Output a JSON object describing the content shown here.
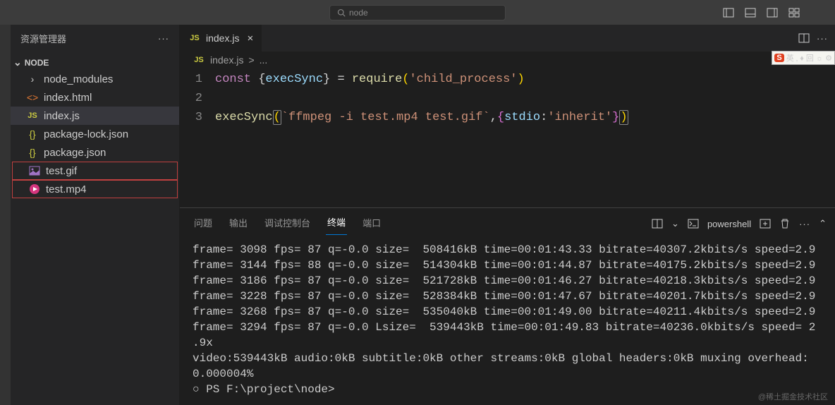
{
  "titlebar": {
    "search_text": "node"
  },
  "sidebar": {
    "title": "资源管理器",
    "folder": "NODE",
    "items": [
      {
        "name": "node_modules",
        "icon": "chev",
        "type": "folder"
      },
      {
        "name": "index.html",
        "icon": "html"
      },
      {
        "name": "index.js",
        "icon": "js",
        "active": true
      },
      {
        "name": "package-lock.json",
        "icon": "json"
      },
      {
        "name": "package.json",
        "icon": "json"
      },
      {
        "name": "test.gif",
        "icon": "img",
        "highlight": true
      },
      {
        "name": "test.mp4",
        "icon": "vid",
        "highlight": true
      }
    ]
  },
  "tab": {
    "filename": "index.js"
  },
  "breadcrumb": {
    "file": "index.js",
    "sep": ">",
    "more": "..."
  },
  "code": {
    "lines": [
      "1",
      "2",
      "3"
    ],
    "l1_const": "const",
    "l1_brace_open": " {",
    "l1_execSync": "execSync",
    "l1_brace_close": "}",
    "l1_eq": " = ",
    "l1_require": "require",
    "l1_paren_open": "(",
    "l1_str": "'child_process'",
    "l1_paren_close": ")",
    "l3_execSync": "execSync",
    "l3_paren_open": "(",
    "l3_str": "`ffmpeg -i test.mp4 test.gif`",
    "l3_comma": ",",
    "l3_opt_open": "{",
    "l3_stdio": "stdio",
    "l3_colon": ":",
    "l3_inherit": "'inherit'",
    "l3_opt_close": "}",
    "l3_paren_close": ")"
  },
  "terminal": {
    "tabs": [
      "问题",
      "输出",
      "调试控制台",
      "终端",
      "端口"
    ],
    "active_tab": 3,
    "shell": "powershell",
    "lines": [
      "frame= 3098 fps= 87 q=-0.0 size=  508416kB time=00:01:43.33 bitrate=40307.2kbits/s speed=2.9",
      "frame= 3144 fps= 88 q=-0.0 size=  514304kB time=00:01:44.87 bitrate=40175.2kbits/s speed=2.9",
      "frame= 3186 fps= 87 q=-0.0 size=  521728kB time=00:01:46.27 bitrate=40218.3kbits/s speed=2.9",
      "frame= 3228 fps= 87 q=-0.0 size=  528384kB time=00:01:47.67 bitrate=40201.7kbits/s speed=2.9",
      "frame= 3268 fps= 87 q=-0.0 size=  535040kB time=00:01:49.00 bitrate=40211.4kbits/s speed=2.9",
      "frame= 3294 fps= 87 q=-0.0 Lsize=  539443kB time=00:01:49.83 bitrate=40236.0kbits/s speed= 2",
      ".9x",
      "video:539443kB audio:0kB subtitle:0kB other streams:0kB global headers:0kB muxing overhead:",
      "0.000004%"
    ],
    "prompt": "PS F:\\project\\node>"
  },
  "ime": {
    "s": "S",
    "text": "英 ",
    "icons": "‚ ♦ 回 ☼ ⚙"
  },
  "watermark": "@稀土掘金技术社区"
}
